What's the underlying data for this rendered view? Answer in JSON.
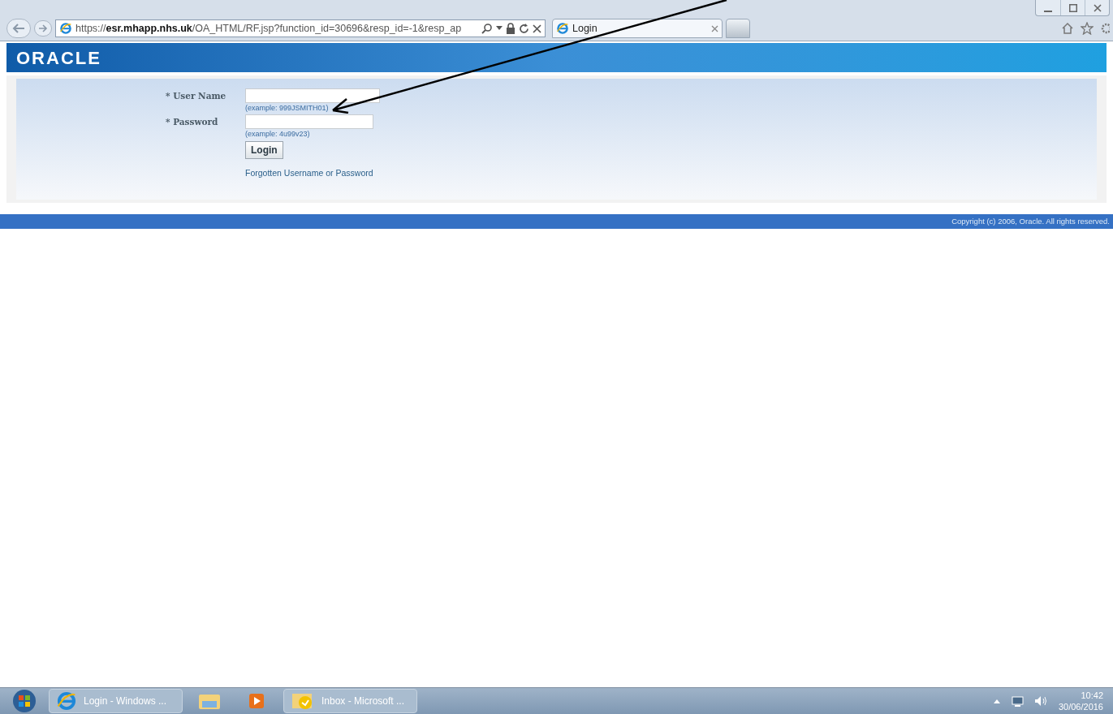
{
  "browser": {
    "address": "https://**esr.mhapp.nhs.uk**/OA_HTML/RF.jsp?function_id=30696&resp_id=-1&resp_ap",
    "tabs": [
      {
        "title": "Login",
        "selected": true
      }
    ]
  },
  "page": {
    "logo": "ORACLE",
    "fields": [
      {
        "label": "User Name",
        "required_mark": "*",
        "hint": "(example: 999JSMITH01)"
      },
      {
        "label": "Password",
        "required_mark": "*",
        "hint": "(example: 4u99v23)"
      }
    ],
    "login_button": "Login",
    "forgot_link": "Forgotten Username or Password",
    "copyright": "Copyright (c) 2006, Oracle. All rights reserved."
  },
  "taskbar": {
    "items": [
      {
        "kind": "ie",
        "label": "Login - Windows ...",
        "selected": true
      },
      {
        "kind": "folder"
      },
      {
        "kind": "media"
      },
      {
        "kind": "outlook",
        "label": "Inbox - Microsoft ...",
        "selected": true
      }
    ],
    "time": "10:42",
    "date": "30/06/2016"
  }
}
